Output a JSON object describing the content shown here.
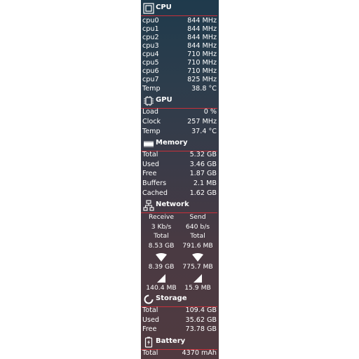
{
  "cpu": {
    "title": "CPU",
    "rows": [
      {
        "label": "cpu0",
        "value": "844 MHz"
      },
      {
        "label": "cpu1",
        "value": "844 MHz"
      },
      {
        "label": "cpu2",
        "value": "844 MHz"
      },
      {
        "label": "cpu3",
        "value": "844 MHz"
      },
      {
        "label": "cpu4",
        "value": "710 MHz"
      },
      {
        "label": "cpu5",
        "value": "710 MHz"
      },
      {
        "label": "cpu6",
        "value": "710 MHz"
      },
      {
        "label": "cpu7",
        "value": "825 MHz"
      },
      {
        "label": "Temp",
        "value": "38.8 °C"
      }
    ]
  },
  "gpu": {
    "title": "GPU",
    "rows": [
      {
        "label": "Load",
        "value": "0 %"
      },
      {
        "label": "Clock",
        "value": "257 MHz"
      },
      {
        "label": "Temp",
        "value": "37.4 °C"
      }
    ]
  },
  "memory": {
    "title": "Memory",
    "rows": [
      {
        "label": "Total",
        "value": "5.32 GB"
      },
      {
        "label": "Used",
        "value": "3.46 GB"
      },
      {
        "label": "Free",
        "value": "1.87 GB"
      },
      {
        "label": "Buffers",
        "value": "2.1 MB"
      },
      {
        "label": "Cached",
        "value": "1.62 GB"
      }
    ]
  },
  "network": {
    "title": "Network",
    "receive": {
      "label": "Receive",
      "rate": "3 Kb/s",
      "total_label": "Total",
      "total": "8.53 GB",
      "wifi": "8.39 GB",
      "mobile": "140.4 MB"
    },
    "send": {
      "label": "Send",
      "rate": "640 b/s",
      "total_label": "Total",
      "total": "791.6 MB",
      "wifi": "775.7 MB",
      "mobile": "15.9 MB"
    }
  },
  "storage": {
    "title": "Storage",
    "rows": [
      {
        "label": "Total",
        "value": "109.4 GB"
      },
      {
        "label": "Used",
        "value": "35.62 GB"
      },
      {
        "label": "Free",
        "value": "73.78 GB"
      }
    ]
  },
  "battery": {
    "title": "Battery",
    "rows": [
      {
        "label": "Total",
        "value": "4370 mAh"
      }
    ]
  },
  "colors": {
    "accent_rule": "#c8303a",
    "text": "#ffffff"
  },
  "icons": {
    "cpu": "cpu-chip-icon",
    "gpu": "gpu-chip-icon",
    "memory": "memory-ram-icon",
    "network": "network-icon",
    "storage": "storage-ring-icon",
    "battery": "battery-icon",
    "wifi": "wifi-icon",
    "mobile": "cell-signal-icon"
  }
}
